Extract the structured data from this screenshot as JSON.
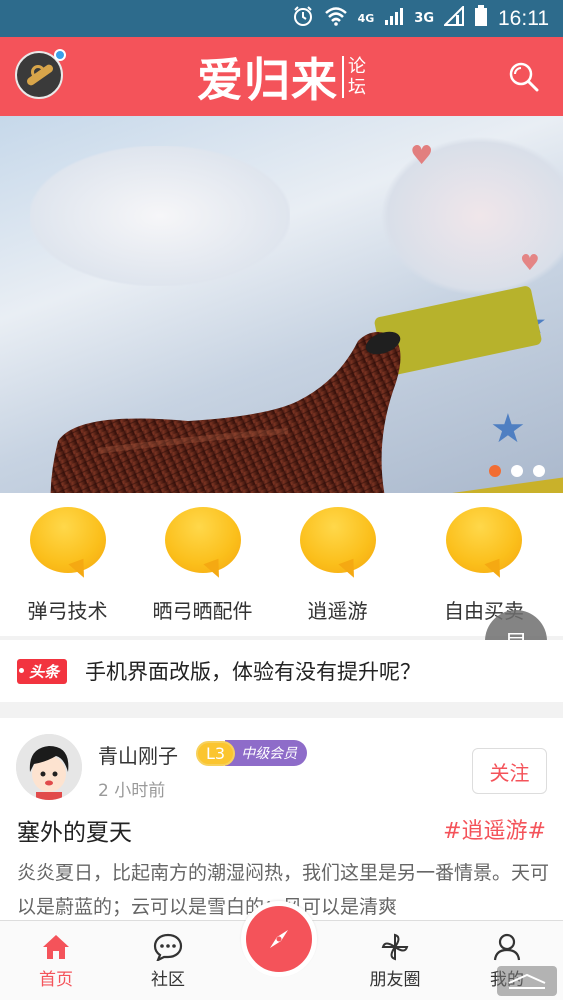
{
  "status_bar": {
    "icons": [
      "alarm-icon",
      "wifi-icon",
      "4g-signal-icon",
      "3g-signal-icon",
      "battery-icon"
    ],
    "network_labels": [
      "4G",
      "3G"
    ],
    "time": "16:11"
  },
  "app_bar": {
    "brand_main": "爱归来",
    "brand_sub": [
      "论",
      "坛"
    ]
  },
  "banner": {
    "slide_count": 3,
    "active_slide": 1
  },
  "categories": [
    {
      "label": "弹弓技术"
    },
    {
      "label": "晒弓晒配件"
    },
    {
      "label": "逍遥游"
    },
    {
      "label": "自由买卖"
    }
  ],
  "float_button": {
    "label": "显"
  },
  "headline": {
    "tag": "头条",
    "text": "手机界面改版，体验有没有提升呢？"
  },
  "post": {
    "username": "青山刚子",
    "level": "L3",
    "rank": "中级会员",
    "time_ago": "2 小时前",
    "follow_label": "关注",
    "title": "塞外的夏天",
    "topic": "#逍遥游#",
    "body": "炎炎夏日，比起南方的潮湿闷热，我们这里是另一番情景。天可以是蔚蓝的；云可以是雪白的；风可以是清爽"
  },
  "bottom_nav": {
    "items": [
      {
        "label": "首页",
        "icon": "home-icon",
        "active": true
      },
      {
        "label": "社区",
        "icon": "chat-icon",
        "active": false
      },
      {
        "label": "",
        "icon": "compass-icon",
        "active": false
      },
      {
        "label": "朋友圈",
        "icon": "pinwheel-icon",
        "active": false
      },
      {
        "label": "我的",
        "icon": "person-icon",
        "active": false
      }
    ]
  },
  "colors": {
    "brand": "#f4535a",
    "status_bar": "#2d6b8c",
    "active_dot": "#f26d33",
    "level_badge": "#fbc52f",
    "rank_badge": "#8e6cc9"
  }
}
